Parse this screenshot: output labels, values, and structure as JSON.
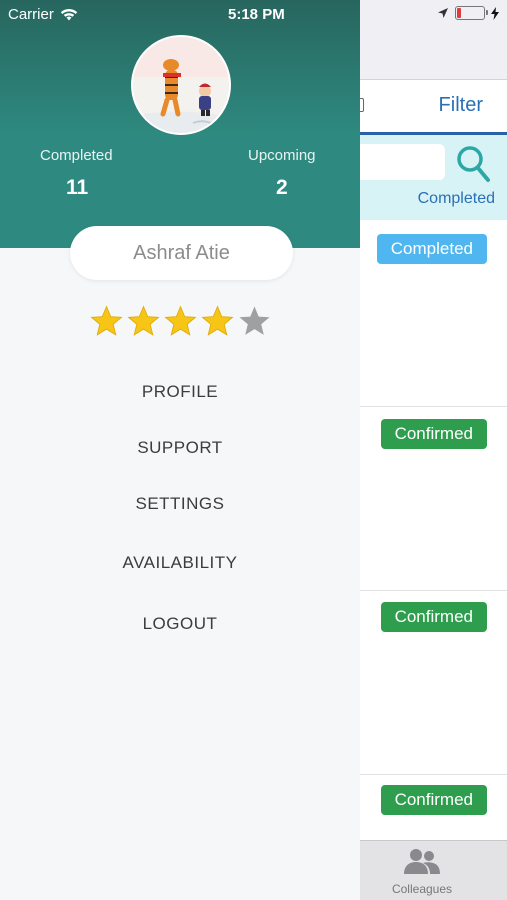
{
  "status_bar": {
    "carrier": "Carrier",
    "time": "5:18 PM"
  },
  "drawer": {
    "stats": {
      "completed_label": "Completed",
      "completed_value": "11",
      "upcoming_label": "Upcoming",
      "upcoming_value": "2"
    },
    "user_name": "Ashraf Atie",
    "rating": {
      "filled": 4,
      "max": 5
    },
    "menu": [
      {
        "label": "PROFILE"
      },
      {
        "label": "SUPPORT"
      },
      {
        "label": "SETTINGS"
      },
      {
        "label": "AVAILABILITY"
      },
      {
        "label": "LOGOUT"
      }
    ]
  },
  "background": {
    "filter_label": "Filter",
    "status_filter": "Completed",
    "rows": [
      {
        "status": "Completed",
        "kind": "completed"
      },
      {
        "status": "Confirmed",
        "kind": "confirmed"
      },
      {
        "status": "Confirmed",
        "kind": "confirmed"
      },
      {
        "status": "Confirmed",
        "kind": "confirmed"
      }
    ],
    "tab_label": "Colleagues"
  },
  "colors": {
    "header_teal": "#2e8a80",
    "star_gold": "#f6c515",
    "star_empty": "#a0a0a0",
    "badge_completed": "#4fb6ef",
    "badge_confirmed": "#2e9e4e",
    "accent_blue": "#2a6fb8"
  },
  "icons": {
    "wifi": "wifi-icon",
    "location": "location-arrow-icon",
    "battery": "battery-low-icon",
    "charging": "charging-bolt-icon",
    "search": "search-icon",
    "colleagues": "colleagues-icon",
    "star": "star-icon"
  }
}
